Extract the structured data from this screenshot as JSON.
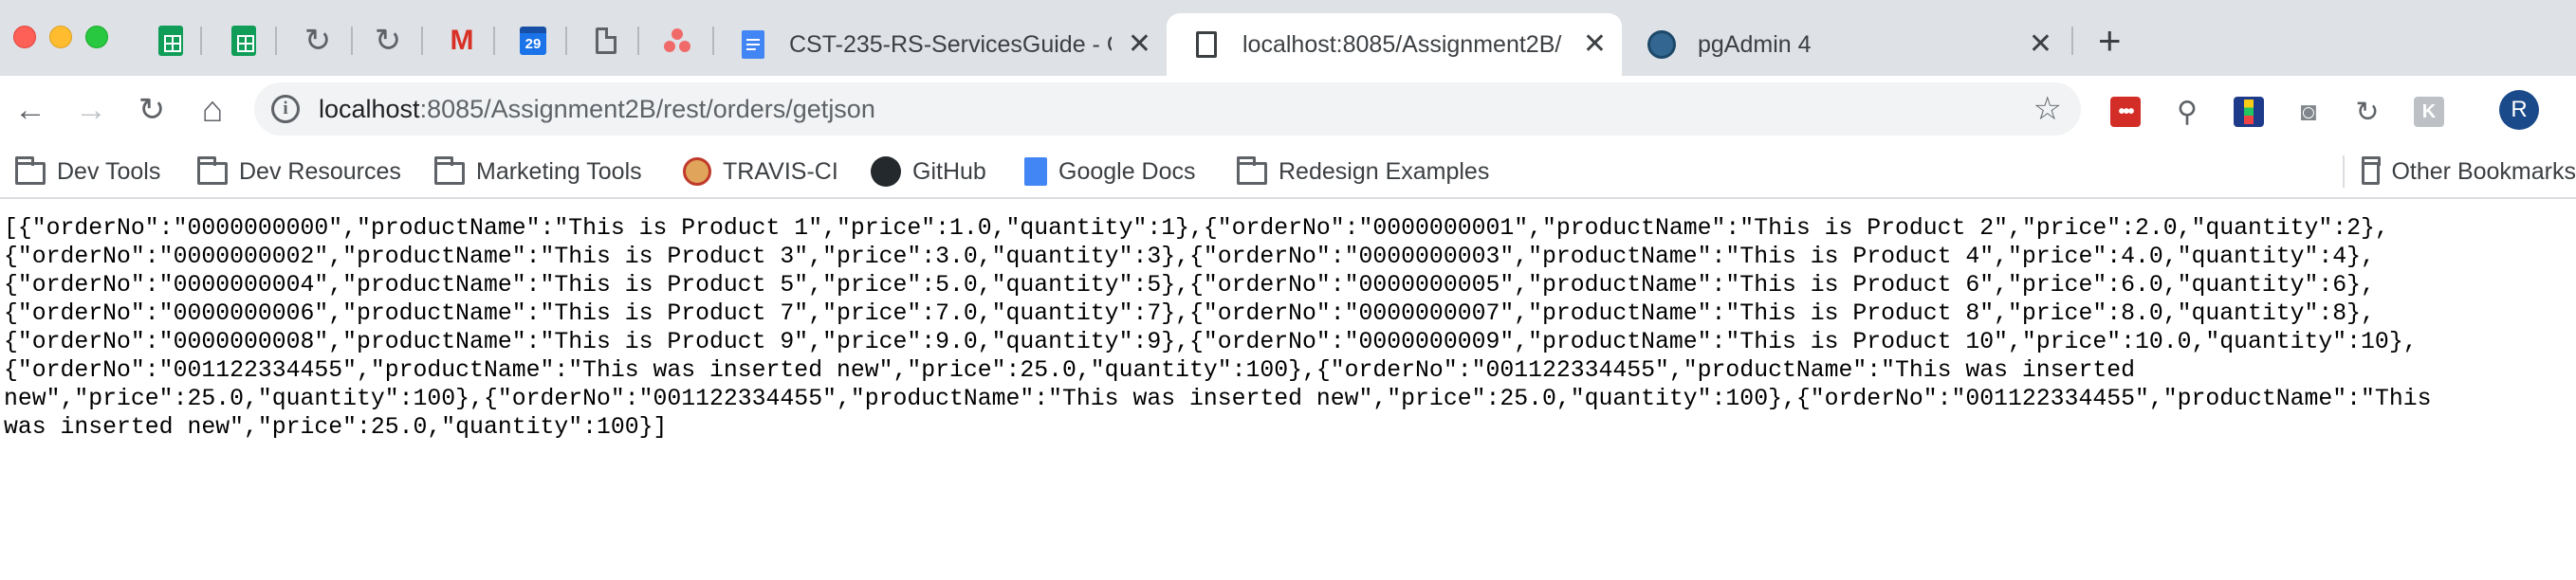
{
  "browser": {
    "pinned_tabs": [
      {
        "icon": "google-sheets-icon"
      },
      {
        "icon": "google-sheets-icon"
      },
      {
        "icon": "reload-icon"
      },
      {
        "icon": "reload-icon"
      },
      {
        "icon": "gmail-icon",
        "glyph": "M"
      },
      {
        "icon": "google-calendar-icon",
        "glyph": "29"
      },
      {
        "icon": "document-icon"
      },
      {
        "icon": "asana-icon"
      }
    ],
    "tabs": [
      {
        "title": "CST-235-RS-ServicesGuide - G",
        "icon": "google-docs-icon",
        "active": false
      },
      {
        "title": "localhost:8085/Assignment2B/",
        "icon": "page-icon",
        "active": true
      },
      {
        "title": "pgAdmin 4",
        "icon": "postgres-elephant-icon",
        "active": false
      }
    ],
    "close_glyph": "✕",
    "new_tab_glyph": "+",
    "nav": {
      "back": "←",
      "forward": "→",
      "reload": "↻",
      "home": "⌂"
    },
    "address": {
      "host": "localhost",
      "path": ":8085/Assignment2B/rest/orders/getjson",
      "info_glyph": "i",
      "star_glyph": "☆"
    },
    "extensions": [
      {
        "icon": "lastpass-icon",
        "glyph": "•••"
      },
      {
        "icon": "eyedropper-icon",
        "glyph": "⚲"
      },
      {
        "icon": "ruler-icon",
        "glyph": ""
      },
      {
        "icon": "camera-icon",
        "glyph": "◙"
      },
      {
        "icon": "refresh-icon",
        "glyph": "↻"
      },
      {
        "icon": "k-extension-icon",
        "glyph": "K"
      }
    ],
    "profile_initial": "R",
    "bookmarks": [
      {
        "label": "Dev Tools",
        "icon": "folder-icon"
      },
      {
        "label": "Dev Resources",
        "icon": "folder-icon"
      },
      {
        "label": "Marketing Tools",
        "icon": "folder-icon"
      },
      {
        "label": "TRAVIS-CI",
        "icon": "travis-ci-icon"
      },
      {
        "label": "GitHub",
        "icon": "github-icon"
      },
      {
        "label": "Google Docs",
        "icon": "google-docs-icon"
      },
      {
        "label": "Redesign Examples",
        "icon": "folder-icon"
      },
      {
        "label": "Other Bookmarks",
        "icon": "folder-icon"
      }
    ]
  },
  "page": {
    "json_lines": [
      "[{\"orderNo\":\"0000000000\",\"productName\":\"This is Product 1\",\"price\":1.0,\"quantity\":1},{\"orderNo\":\"0000000001\",\"productName\":\"This is Product 2\",\"price\":2.0,\"quantity\":2},",
      "{\"orderNo\":\"0000000002\",\"productName\":\"This is Product 3\",\"price\":3.0,\"quantity\":3},{\"orderNo\":\"0000000003\",\"productName\":\"This is Product 4\",\"price\":4.0,\"quantity\":4},",
      "{\"orderNo\":\"0000000004\",\"productName\":\"This is Product 5\",\"price\":5.0,\"quantity\":5},{\"orderNo\":\"0000000005\",\"productName\":\"This is Product 6\",\"price\":6.0,\"quantity\":6},",
      "{\"orderNo\":\"0000000006\",\"productName\":\"This is Product 7\",\"price\":7.0,\"quantity\":7},{\"orderNo\":\"0000000007\",\"productName\":\"This is Product 8\",\"price\":8.0,\"quantity\":8},",
      "{\"orderNo\":\"0000000008\",\"productName\":\"This is Product 9\",\"price\":9.0,\"quantity\":9},{\"orderNo\":\"0000000009\",\"productName\":\"This is Product 10\",\"price\":10.0,\"quantity\":10},",
      "{\"orderNo\":\"001122334455\",\"productName\":\"This was inserted new\",\"price\":25.0,\"quantity\":100},{\"orderNo\":\"001122334455\",\"productName\":\"This was inserted",
      "new\",\"price\":25.0,\"quantity\":100},{\"orderNo\":\"001122334455\",\"productName\":\"This was inserted new\",\"price\":25.0,\"quantity\":100},{\"orderNo\":\"001122334455\",\"productName\":\"This",
      "was inserted new\",\"price\":25.0,\"quantity\":100}]"
    ]
  }
}
